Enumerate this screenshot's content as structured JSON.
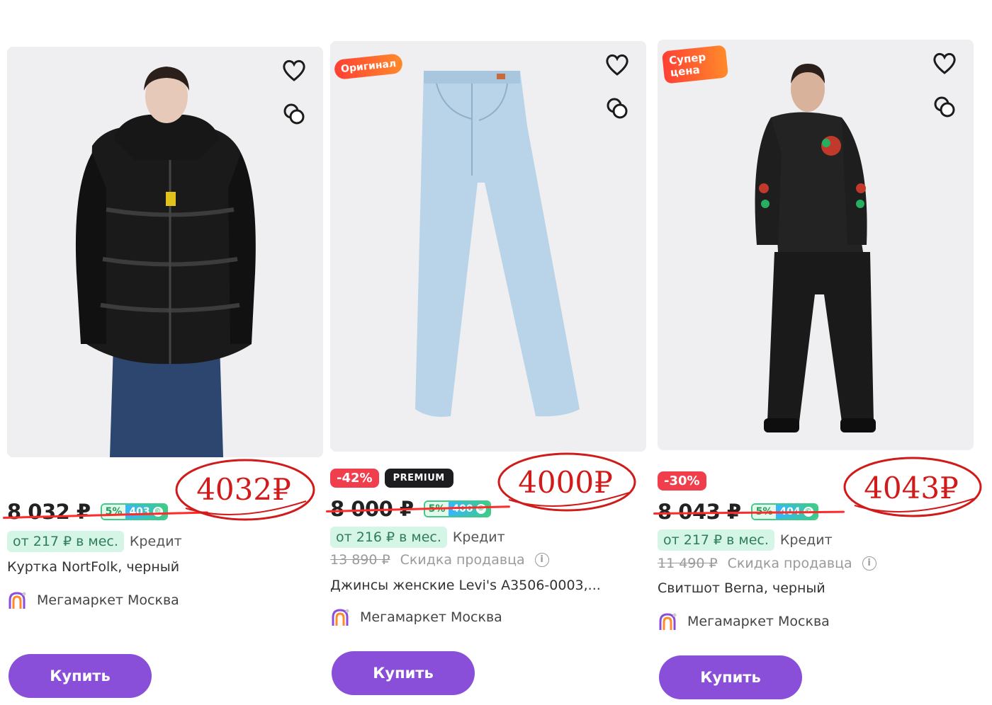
{
  "buy_label": "Купить",
  "credit_label": "Кредит",
  "seller_discount_label": "Скидка продавца",
  "colors": {
    "buy": "#8a4fd8",
    "credit_bg": "#d5f6e6",
    "discount": "#f13e4c",
    "ink": "#d11a1a"
  },
  "products": [
    {
      "title": "Куртка NortFolk, черный",
      "price": "8 032 ₽",
      "bonus_pct": "5%",
      "bonus_amount": "403",
      "credit": "от 217 ₽ в мес.",
      "seller": "Мегамаркет Москва",
      "handwritten_price": "4032₽",
      "badge": "",
      "discount": "",
      "old_price": ""
    },
    {
      "title": "Джинсы женские Levi's A3506-0003,...",
      "price": "8 000 ₽",
      "bonus_pct": "5%",
      "bonus_amount": "400",
      "credit": "от 216 ₽ в мес.",
      "seller": "Мегамаркет Москва",
      "handwritten_price": "4000₽",
      "badge": "Оригинал",
      "discount": "-42%",
      "premium": "PREMIUM",
      "old_price": "13 890 ₽"
    },
    {
      "title": "Свитшот Berna, черный",
      "price": "8 043 ₽",
      "bonus_pct": "5%",
      "bonus_amount": "404",
      "credit": "от 217 ₽ в мес.",
      "seller": "Мегамаркет Москва",
      "handwritten_price": "4043₽",
      "badge": "Супер цена",
      "discount": "-30%",
      "old_price": "11 490 ₽"
    }
  ]
}
